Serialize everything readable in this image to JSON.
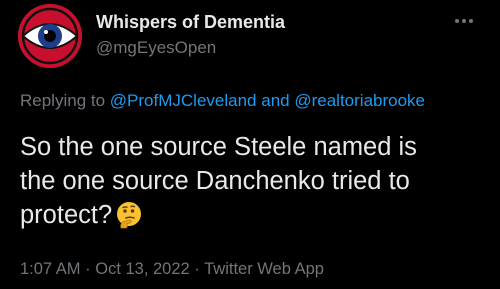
{
  "author": {
    "display_name": "Whispers of Dementia",
    "handle": "@mgEyesOpen",
    "avatar_icon": "eye-avatar"
  },
  "reply": {
    "prefix": "Replying to",
    "mention_1": "@ProfMJCleveland",
    "conjunction": "and",
    "mention_2": "@realtoriabrooke"
  },
  "tweet": {
    "line_1": "So the one source Steele named is",
    "line_2": "the one source Danchenko tried to",
    "line_3": "protect?",
    "emoji": "thinking-face-emoji"
  },
  "meta": {
    "time": "1:07 AM",
    "separator": "·",
    "date": "Oct 13, 2022",
    "source": "Twitter Web App"
  },
  "colors": {
    "background": "#000000",
    "text": "#e7e9ea",
    "secondary": "#71767b",
    "link": "#1d9bf0"
  }
}
